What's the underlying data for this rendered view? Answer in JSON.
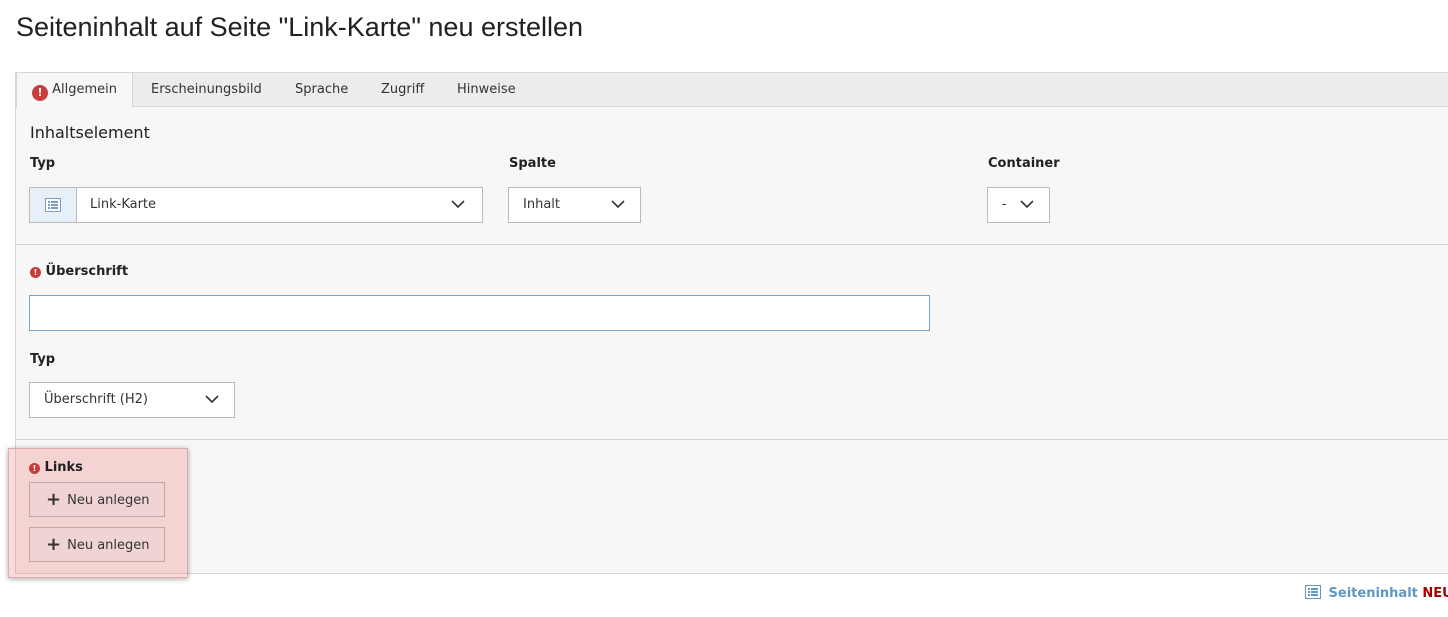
{
  "title": "Seiteninhalt auf Seite \"Link-Karte\" neu erstellen",
  "tabs": [
    {
      "label": "Allgemein",
      "active": true,
      "error": true
    },
    {
      "label": "Erscheinungsbild"
    },
    {
      "label": "Sprache"
    },
    {
      "label": "Zugriff"
    },
    {
      "label": "Hinweise"
    }
  ],
  "general": {
    "section_title": "Inhaltselement",
    "type": {
      "label": "Typ",
      "value": "Link-Karte"
    },
    "column": {
      "label": "Spalte",
      "value": "Inhalt"
    },
    "container": {
      "label": "Container",
      "value": "-"
    }
  },
  "header_section": {
    "label": "Überschrift",
    "value": "",
    "type": {
      "label": "Typ",
      "value": "Überschrift (H2)"
    }
  },
  "links_section": {
    "label": "Links",
    "buttons": [
      "Neu anlegen",
      "Neu anlegen"
    ]
  },
  "status": {
    "label": "Seiteninhalt",
    "state": "NEU"
  },
  "colors": {
    "error": "#c83c3c",
    "accent": "#5f97c4",
    "new_state": "#a40000",
    "highlight": "#f0d3d3"
  }
}
